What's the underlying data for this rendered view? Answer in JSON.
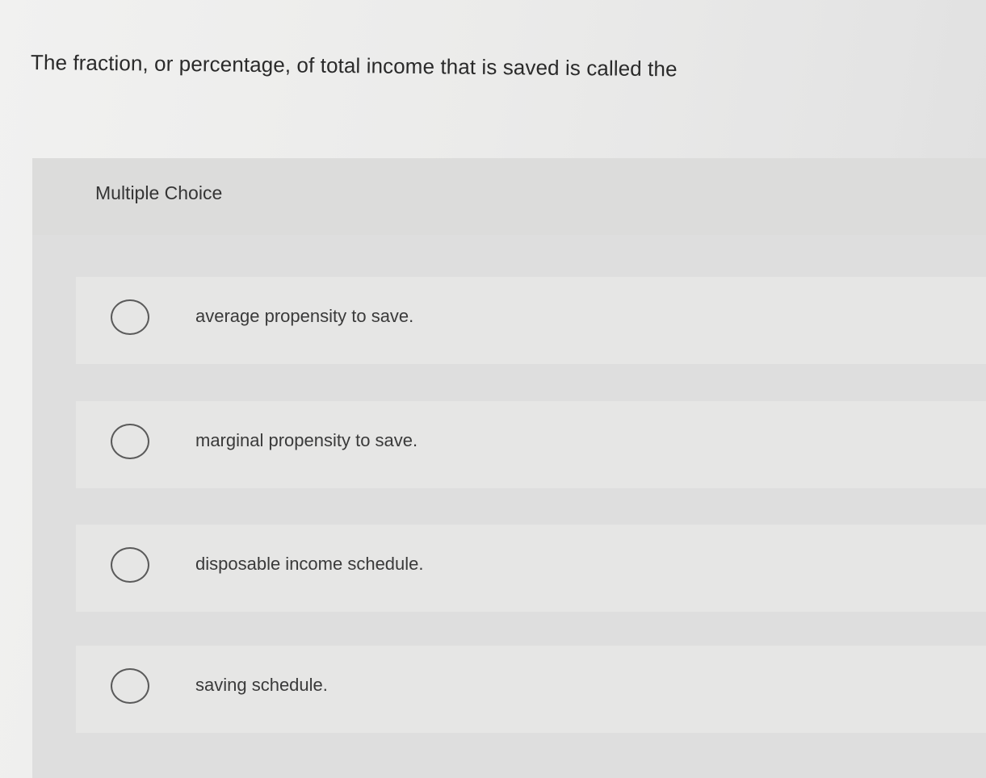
{
  "question": {
    "text": "The fraction, or percentage, of total income that is saved is called the"
  },
  "multiple_choice": {
    "label": "Multiple Choice",
    "options": [
      {
        "label": "average propensity to save."
      },
      {
        "label": "marginal propensity to save."
      },
      {
        "label": "disposable income schedule."
      },
      {
        "label": "saving schedule."
      }
    ]
  }
}
